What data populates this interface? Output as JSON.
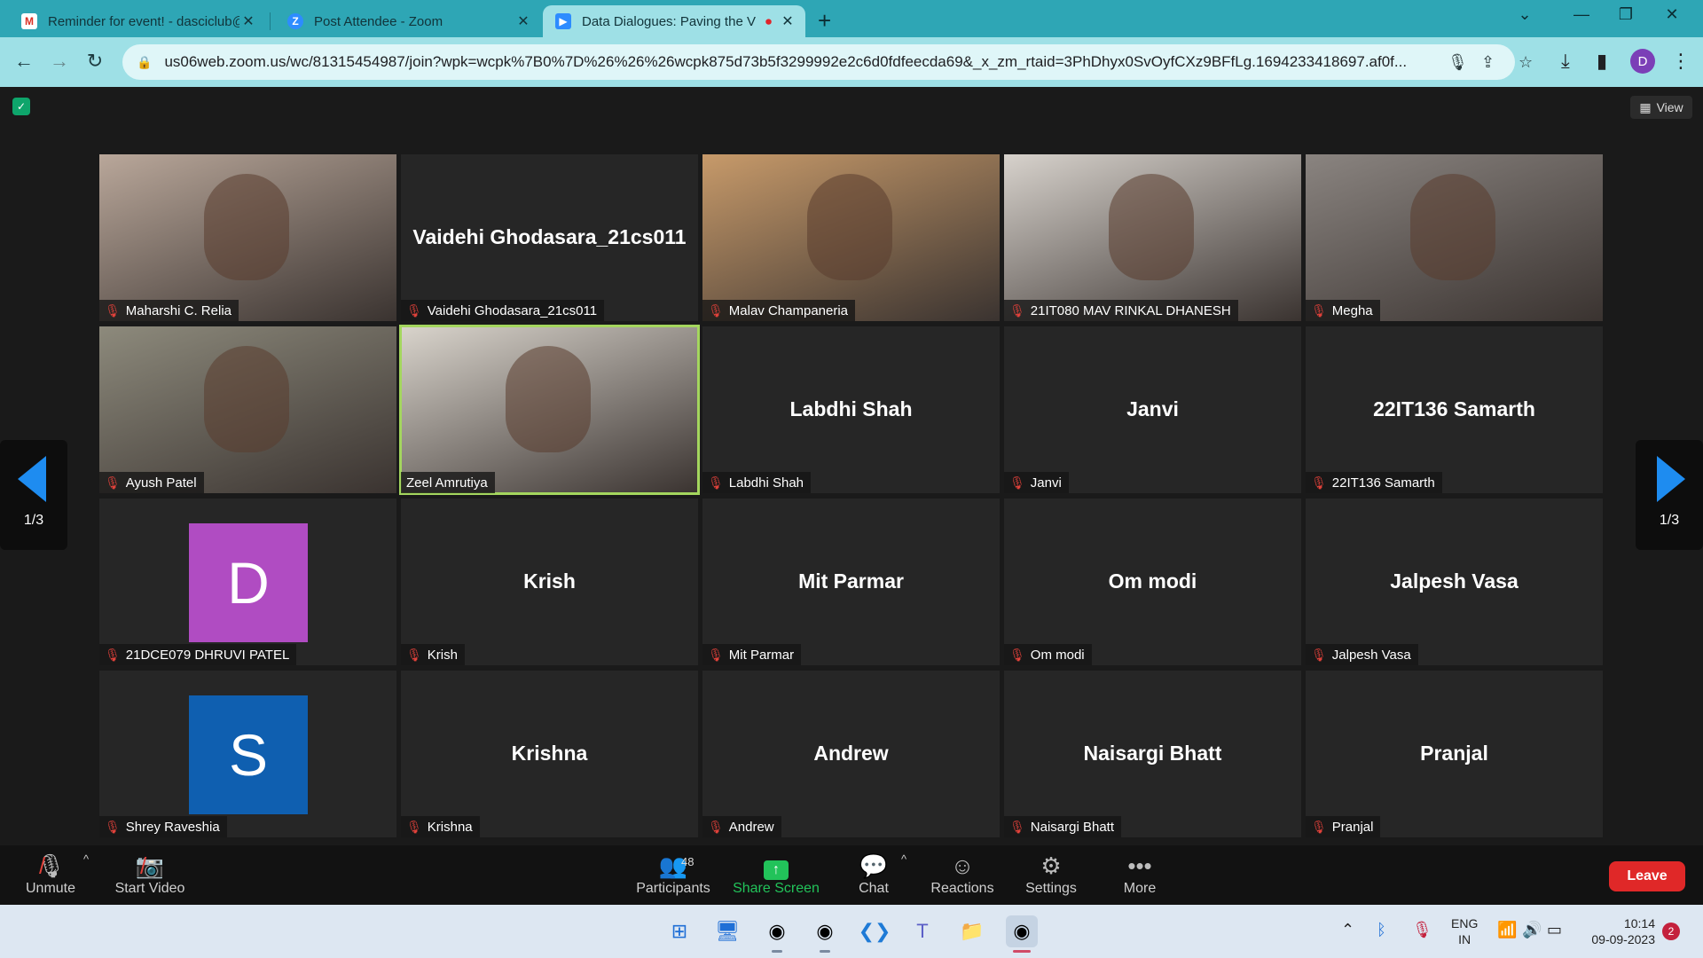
{
  "browser": {
    "tabs": [
      {
        "title": "Reminder for event! - dasciclub@",
        "favicon": "gmail-icon",
        "close": "✕"
      },
      {
        "title": "Post Attendee - Zoom",
        "favicon": "zoom-icon",
        "close": "✕"
      },
      {
        "title": "Data Dialogues: Paving the V",
        "favicon": "zoom-video-icon",
        "close": "✕",
        "active": true
      }
    ],
    "url": "us06web.zoom.us/wc/81315454987/join?wpk=wcpk%7B0%7D%26%26%26wcpk875d73b5f3299992e2c6d0fdfeecda69&_x_zm_rtaid=3PhDhyx0SvOyfCXz9BFfLg.1694233418697.af0f...",
    "profile_initial": "D"
  },
  "meeting": {
    "view_label": "View",
    "page_indicator": "1/3",
    "participants": [
      {
        "name": "Maharshi C. Relia",
        "video": true
      },
      {
        "name": "Vaidehi Ghodasara_21cs011",
        "video": false
      },
      {
        "name": "Malav Champaneria",
        "video": true
      },
      {
        "name": "21IT080 MAV RINKAL DHANESH",
        "video": true
      },
      {
        "name": "Megha",
        "video": true
      },
      {
        "name": "Ayush Patel",
        "video": true
      },
      {
        "name": "Zeel Amrutiya",
        "video": true,
        "speaking": true
      },
      {
        "name": "Labdhi Shah",
        "video": false
      },
      {
        "name": "Janvi",
        "video": false
      },
      {
        "name": "22IT136 Samarth",
        "video": false
      },
      {
        "name": "21DCE079 DHRUVI PATEL",
        "video": false,
        "avatar": "D",
        "avatar_color": "#b04cc2"
      },
      {
        "name": "Krish",
        "video": false
      },
      {
        "name": "Mit Parmar",
        "video": false
      },
      {
        "name": "Om modi",
        "video": false
      },
      {
        "name": "Jalpesh Vasa",
        "video": false
      },
      {
        "name": "Shrey Raveshia",
        "video": false,
        "avatar": "S",
        "avatar_color": "#0f5fb0"
      },
      {
        "name": "Krishna",
        "video": false
      },
      {
        "name": "Andrew",
        "video": false
      },
      {
        "name": "Naisargi Bhatt",
        "video": false
      },
      {
        "name": "Pranjal",
        "video": false
      }
    ]
  },
  "toolbar": {
    "unmute": "Unmute",
    "start_video": "Start Video",
    "participants": "Participants",
    "participants_count": "48",
    "share_screen": "Share Screen",
    "chat": "Chat",
    "reactions": "Reactions",
    "settings": "Settings",
    "more": "More",
    "leave": "Leave"
  },
  "taskbar": {
    "lang_top": "ENG",
    "lang_bottom": "IN",
    "time": "10:14",
    "date": "09-09-2023",
    "notifications": "2"
  },
  "colors": {
    "accent_share": "#22c35a",
    "leave": "#e02828",
    "speaking_border": "#a4d65e",
    "pager_arrow": "#1e8cf0"
  }
}
